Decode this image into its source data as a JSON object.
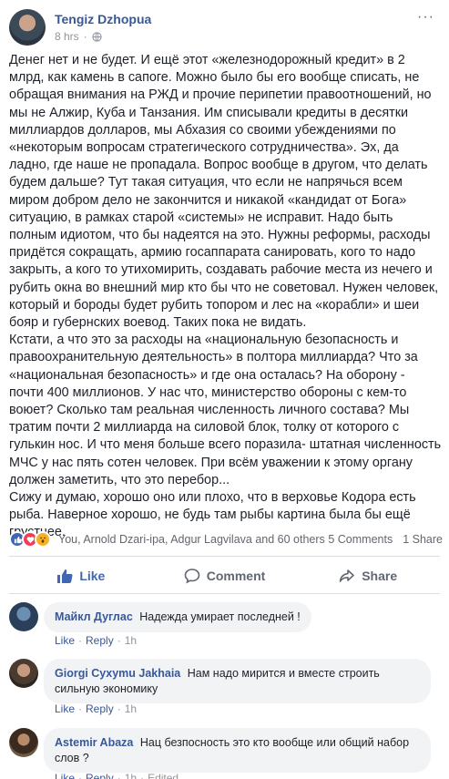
{
  "post": {
    "author": "Tengiz Dzhopua",
    "time": "8 hrs",
    "more": "···",
    "body": [
      "Денег нет и не будет. И ещё этот «железнодорожный кредит» в 2 млрд, как камень в сапоге. Можно было бы его вообще списать, не обращая внимания на РЖД и прочие перипетии правоотношений, но мы не Алжир, Куба и Танзания. Им списывали кредиты в десятки миллиардов долларов, мы Абхазия со своими убеждениями по «некоторым вопросам стратегического сотрудничества». Эх, да ладно, где наше не пропадала. Вопрос вообще в другом, что делать будем дальше? Тут такая ситуация, что если не напрячься всем миром добром дело не закончится и никакой «кандидат от Бога» ситуацию, в рамках старой «системы» не исправит. Надо быть полным идиотом, что бы надеятся на это. Нужны реформы, расходы придётся сокращать, армию госаппарата санировать, кого то надо закрыть, а кого то утихомирить, создавать рабочие места из нечего и рубить окна во внешний мир кто бы что не советовал. Нужен человек, который и бороды будет рубить топором и лес на «корабли» и шеи бояр и губернских воевод. Таких пока не видать.",
      "Кстати, а что это за расходы на «национальную безопасность и правоохранительную деятельность» в полтора миллиарда? Что за «национальная безопасность» и где она осталась? На оборону - почти 400 миллионов. У нас что, министерство обороны с кем-то воюет? Сколько там реальная численность личного состава? Мы тратим почти 2 миллиарда на силовой блок, толку от которого с гулькин нос. И что меня больше всего поразила- штатная численность МЧС у нас пять сотен человек. При всём уважении к этому органу должен заметить, что это перебор...",
      "Сижу и думаю, хорошо оно или плохо, что в верховье Кодора есть рыба. Наверное хорошо, не будь там рыбы картина была бы ещё грустнее."
    ],
    "reactions_text": "You, Arnold Dzari-ipa, Adgur Lagvilava and 60 others",
    "comments_count": "5 Comments",
    "shares_count": "1 Share"
  },
  "actions": {
    "like": "Like",
    "comment": "Comment",
    "share": "Share"
  },
  "comments": [
    {
      "name": "Майкл Дуглас",
      "text": "Надежда умирает последней !",
      "like": "Like",
      "reply": "Reply",
      "time": "1h"
    },
    {
      "name": "Giorgi Cyxymu Jakhaia",
      "text": "Нам надо мирится и вместе строить сильную экономику",
      "like": "Like",
      "reply": "Reply",
      "time": "1h"
    },
    {
      "name": "Astemir Abaza",
      "text": "Нац безпосность это кто вообще или общий набор слов ?",
      "like": "Like",
      "reply": "Reply",
      "time": "1h",
      "edited": "Edited"
    }
  ],
  "colors": {
    "link_blue": "#385898",
    "like_blue": "#4267b2",
    "muted": "#90949c",
    "bubble": "#f2f3f5"
  }
}
